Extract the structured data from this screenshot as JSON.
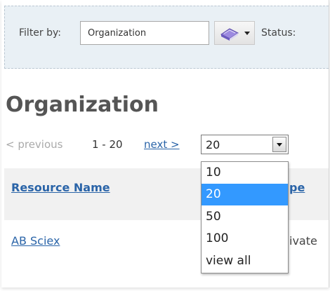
{
  "filter": {
    "label": "Filter by:",
    "input_value": "Organization",
    "type_icon": "book-icon",
    "status_label": "Status:"
  },
  "page": {
    "title": "Organization"
  },
  "pagination": {
    "previous": "< previous",
    "range": "1 - 20",
    "next": "next >"
  },
  "page_size": {
    "selected": "20",
    "options": [
      "10",
      "20",
      "50",
      "100",
      "view all"
    ],
    "highlight_color": "#3399ff"
  },
  "table": {
    "header_name": "Resource Name",
    "header_type_visible": "pe",
    "rows": [
      {
        "name": "AB Sciex",
        "type_visible": "ivate"
      }
    ]
  },
  "colors": {
    "link": "#2a64a8",
    "filter_bg": "#e9f0f5"
  }
}
